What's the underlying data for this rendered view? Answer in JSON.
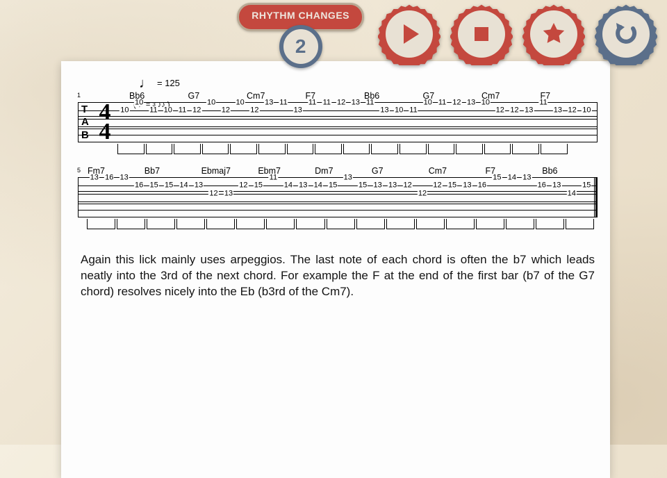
{
  "badge": {
    "title": "RHYTHM CHANGES",
    "number": "2"
  },
  "buttons": {
    "play": "play",
    "stop": "stop",
    "star": "favorite",
    "back": "back"
  },
  "tempo": {
    "label": "= 125"
  },
  "swing": {
    "left": "♫",
    "eq": "=",
    "right": "♪♪",
    "triplet": "3"
  },
  "time_sig": {
    "top": "4",
    "bottom": "4"
  },
  "tab_label": [
    "T",
    "A",
    "B"
  ],
  "bar_numbers": {
    "sys1": "1",
    "sys2": "5"
  },
  "system1": {
    "chords": [
      "Bb6",
      "G7",
      "Cm7",
      "F7",
      "Bb6",
      "G7",
      "Cm7",
      "F7"
    ],
    "notes": [
      {
        "s": 2,
        "f": "10"
      },
      {
        "s": 1,
        "f": "10"
      },
      {
        "s": 2,
        "f": "11"
      },
      {
        "s": 2,
        "f": "10"
      },
      {
        "s": 2,
        "f": "11"
      },
      {
        "s": 2,
        "f": "12"
      },
      {
        "s": 1,
        "f": "10"
      },
      {
        "s": 2,
        "f": "12"
      },
      {
        "s": 1,
        "f": "10"
      },
      {
        "s": 2,
        "f": "12"
      },
      {
        "s": 1,
        "f": "13"
      },
      {
        "s": 1,
        "f": "11"
      },
      {
        "s": 2,
        "f": "13"
      },
      {
        "s": 1,
        "f": "11"
      },
      {
        "s": 1,
        "f": "11"
      },
      {
        "s": 1,
        "f": "12"
      },
      {
        "s": 1,
        "f": "13"
      },
      {
        "s": 1,
        "f": "11"
      },
      {
        "s": 2,
        "f": "13"
      },
      {
        "s": 2,
        "f": "10"
      },
      {
        "s": 2,
        "f": "11"
      },
      {
        "s": 1,
        "f": "10"
      },
      {
        "s": 1,
        "f": "11"
      },
      {
        "s": 1,
        "f": "12"
      },
      {
        "s": 1,
        "f": "13"
      },
      {
        "s": 1,
        "f": "10"
      },
      {
        "s": 2,
        "f": "12"
      },
      {
        "s": 2,
        "f": "12"
      },
      {
        "s": 2,
        "f": "13"
      },
      {
        "s": 1,
        "f": "11"
      },
      {
        "s": 2,
        "f": "13"
      },
      {
        "s": 2,
        "f": "12"
      },
      {
        "s": 2,
        "f": "10"
      }
    ]
  },
  "system2": {
    "chords": [
      "Fm7",
      "Bb7",
      "Ebmaj7",
      "Ebm7",
      "Dm7",
      "G7",
      "Cm7",
      "F7",
      "Bb6"
    ],
    "notes": [
      {
        "s": 1,
        "f": "13"
      },
      {
        "s": 1,
        "f": "16"
      },
      {
        "s": 1,
        "f": "13"
      },
      {
        "s": 2,
        "f": "16"
      },
      {
        "s": 2,
        "f": "15"
      },
      {
        "s": 2,
        "f": "15"
      },
      {
        "s": 2,
        "f": "14"
      },
      {
        "s": 2,
        "f": "13"
      },
      {
        "s": 3,
        "f": "12"
      },
      {
        "s": 3,
        "f": "13"
      },
      {
        "s": 2,
        "f": "12"
      },
      {
        "s": 2,
        "f": "15"
      },
      {
        "s": 1,
        "f": "11"
      },
      {
        "s": 2,
        "f": "14"
      },
      {
        "s": 2,
        "f": "13"
      },
      {
        "s": 2,
        "f": "14"
      },
      {
        "s": 2,
        "f": "15"
      },
      {
        "s": 1,
        "f": "13"
      },
      {
        "s": 2,
        "f": "15"
      },
      {
        "s": 2,
        "f": "13"
      },
      {
        "s": 2,
        "f": "13"
      },
      {
        "s": 2,
        "f": "12"
      },
      {
        "s": 3,
        "f": "12"
      },
      {
        "s": 2,
        "f": "12"
      },
      {
        "s": 2,
        "f": "15"
      },
      {
        "s": 2,
        "f": "13"
      },
      {
        "s": 2,
        "f": "16"
      },
      {
        "s": 1,
        "f": "15"
      },
      {
        "s": 1,
        "f": "14"
      },
      {
        "s": 1,
        "f": "13"
      },
      {
        "s": 2,
        "f": "16"
      },
      {
        "s": 2,
        "f": "13"
      },
      {
        "s": 3,
        "f": "14"
      },
      {
        "s": 2,
        "f": "15"
      }
    ]
  },
  "paragraph": "Again this lick mainly uses arpeggios. The last note of each chord is often the b7 which leads neatly into the 3rd of the next chord. For example the F at the end of the first bar (b7 of the G7 chord) resolves nicely into the Eb (b3rd of the Cm7)."
}
